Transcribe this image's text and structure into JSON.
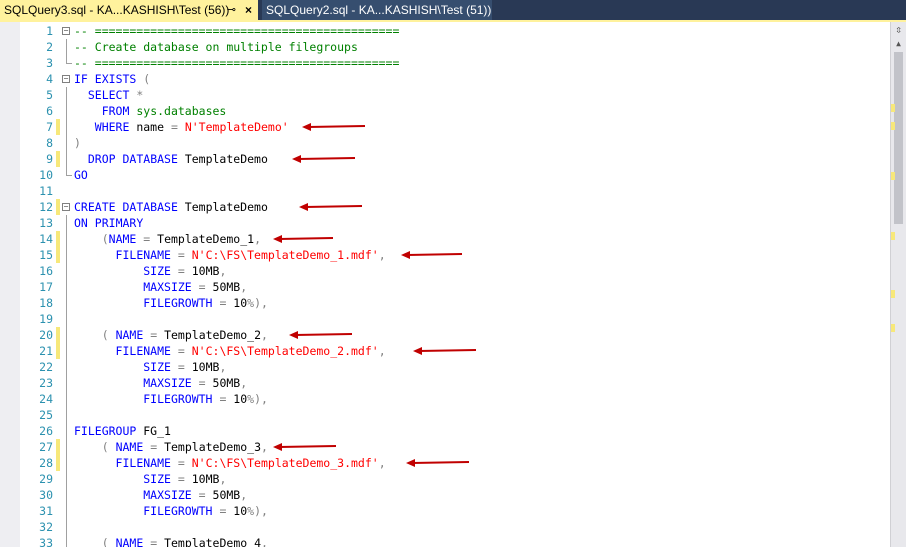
{
  "tabs": [
    {
      "label": "SQLQuery3.sql - KA...KASHISH\\Test (56))",
      "pin_icon": "pin-icon",
      "close_icon": "close-icon",
      "active": true
    },
    {
      "label": "SQLQuery2.sql - KA...KASHISH\\Test (51))",
      "active": false
    }
  ],
  "colors": {
    "keyword": "#0000ff",
    "string": "#ff0000",
    "comment": "#008000",
    "line_number": "#2b91af",
    "arrow": "#c00000",
    "change_marker": "#f7e87a",
    "active_tab": "#fff29d",
    "tab_strip": "#293955"
  },
  "editor": {
    "lines": [
      {
        "n": "1",
        "t": "-- ============================================"
      },
      {
        "n": "2",
        "t": "-- Create database on multiple filegroups"
      },
      {
        "n": "3",
        "t": "-- ============================================"
      },
      {
        "n": "4",
        "t": "IF EXISTS ("
      },
      {
        "n": "5",
        "t": "  SELECT *"
      },
      {
        "n": "6",
        "t": "    FROM sys.databases"
      },
      {
        "n": "7",
        "t": "   WHERE name = N'TemplateDemo'"
      },
      {
        "n": "8",
        "t": ")"
      },
      {
        "n": "9",
        "t": "  DROP DATABASE TemplateDemo"
      },
      {
        "n": "10",
        "t": "GO"
      },
      {
        "n": "11",
        "t": ""
      },
      {
        "n": "12",
        "t": "CREATE DATABASE TemplateDemo"
      },
      {
        "n": "13",
        "t": "ON PRIMARY"
      },
      {
        "n": "14",
        "t": "    (NAME = TemplateDemo_1,"
      },
      {
        "n": "15",
        "t": "      FILENAME = N'C:\\FS\\TemplateDemo_1.mdf',"
      },
      {
        "n": "16",
        "t": "          SIZE = 10MB,"
      },
      {
        "n": "17",
        "t": "          MAXSIZE = 50MB,"
      },
      {
        "n": "18",
        "t": "          FILEGROWTH = 10%),"
      },
      {
        "n": "19",
        "t": ""
      },
      {
        "n": "20",
        "t": "    ( NAME = TemplateDemo_2,"
      },
      {
        "n": "21",
        "t": "      FILENAME = N'C:\\FS\\TemplateDemo_2.mdf',"
      },
      {
        "n": "22",
        "t": "          SIZE = 10MB,"
      },
      {
        "n": "23",
        "t": "          MAXSIZE = 50MB,"
      },
      {
        "n": "24",
        "t": "          FILEGROWTH = 10%),"
      },
      {
        "n": "25",
        "t": ""
      },
      {
        "n": "26",
        "t": "FILEGROUP FG_1"
      },
      {
        "n": "27",
        "t": "    ( NAME = TemplateDemo_3,"
      },
      {
        "n": "28",
        "t": "      FILENAME = N'C:\\FS\\TemplateDemo_3.mdf',"
      },
      {
        "n": "29",
        "t": "          SIZE = 10MB,"
      },
      {
        "n": "30",
        "t": "          MAXSIZE = 50MB,"
      },
      {
        "n": "31",
        "t": "          FILEGROWTH = 10%),"
      },
      {
        "n": "32",
        "t": ""
      },
      {
        "n": "33",
        "t": "    ( NAME = TemplateDemo 4,"
      }
    ]
  },
  "scrollbar": {
    "split_icon": "split-window-icon",
    "up_icon": "scroll-up-arrow-icon"
  }
}
